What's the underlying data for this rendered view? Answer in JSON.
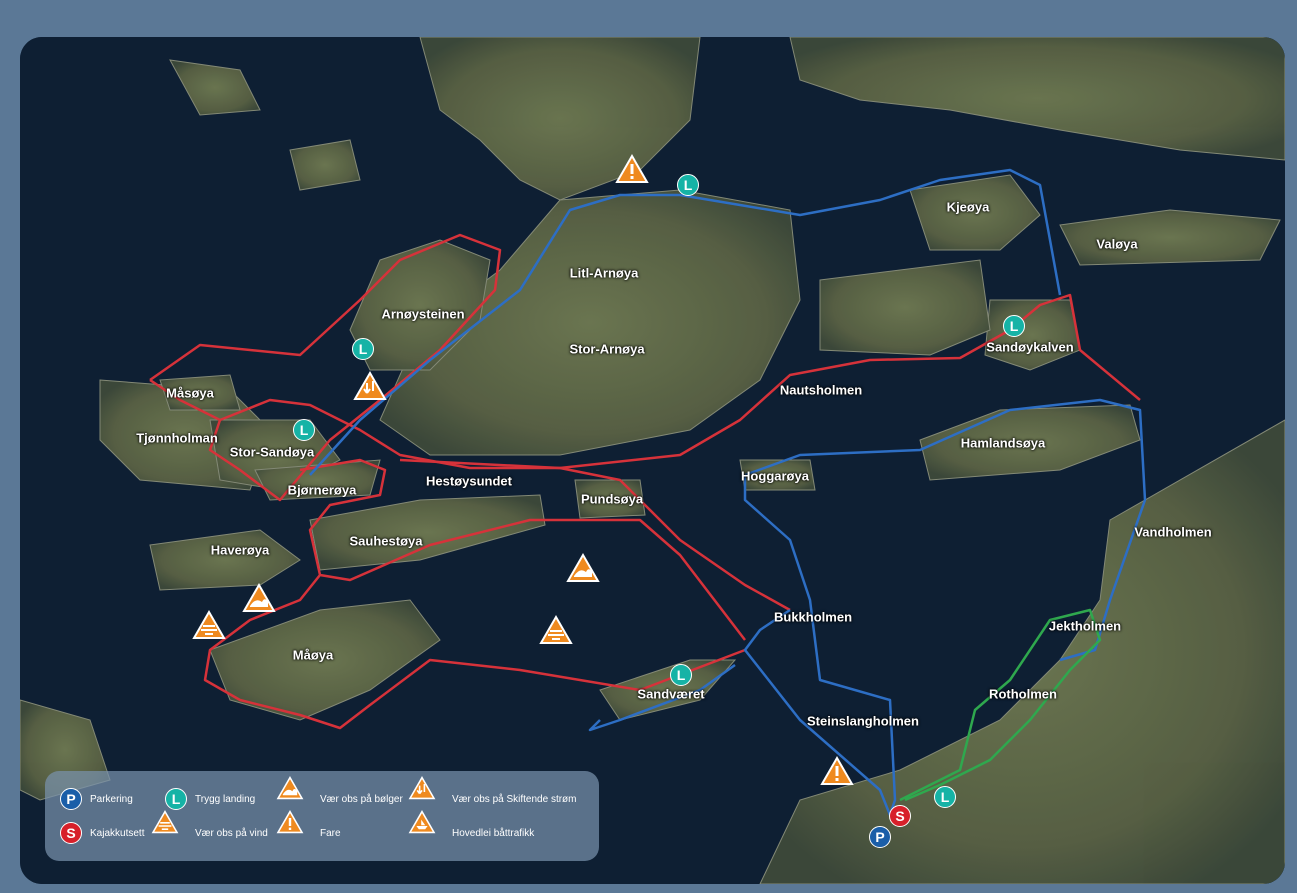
{
  "places": {
    "litl_arnoya": "Litl-Arnøya",
    "stor_arnoya": "Stor-Arnøya",
    "arnoysteinen": "Arnøysteinen",
    "masoya": "Måsøya",
    "tjonnholman": "Tjønnholman",
    "stor_sandoya": "Stor-Sandøya",
    "bjornaroya": "Bjørnerøya",
    "hestoysundet": "Hestøysundet",
    "pundsoya": "Pundsøya",
    "haveroya": "Haverøya",
    "sauhestoya": "Sauhestøya",
    "maoya": "Måøya",
    "sandvaeret": "Sandværet",
    "bukkholmen": "Bukkholmen",
    "steinslangholmen": "Steinslangholmen",
    "hoggaroya": "Hoggarøya",
    "nautsholmen": "Nautsholmen",
    "hamlandsoya": "Hamlandsøya",
    "sandoykalven": "Sandøykalven",
    "kjeoya": "Kjeøya",
    "valoya": "Valøya",
    "vandholmen": "Vandholmen",
    "jektholmen": "Jektholmen",
    "rotholmen": "Rotholmen"
  },
  "markers": {
    "landing_letter": "L",
    "start_letter": "S",
    "parking_letter": "P"
  },
  "legend": {
    "parking": "Parkering",
    "kayak_start": "Kajakkutsett",
    "safe_landing": "Trygg landing",
    "wind": "Vær obs på vind",
    "waves": "Vær obs på bølger",
    "danger": "Fare",
    "current": "Vær obs på Skiftende strøm",
    "boat_traffic": "Hovedlei båttrafikk"
  },
  "colors": {
    "water": "#0e1f33",
    "route_red": "#d6323a",
    "route_blue": "#2d6ec4",
    "route_green": "#2fa84e",
    "warning_orange": "#ef8a1f",
    "landing_teal": "#16b3a6",
    "start_red": "#d7202a",
    "parking_blue": "#1a5ea8",
    "frame": "#5b7896"
  },
  "icons": {
    "wind": "wind-warning-icon",
    "waves": "wave-warning-icon",
    "danger": "danger-warning-icon",
    "current": "current-warning-icon",
    "boat_traffic": "boat-traffic-warning-icon"
  }
}
